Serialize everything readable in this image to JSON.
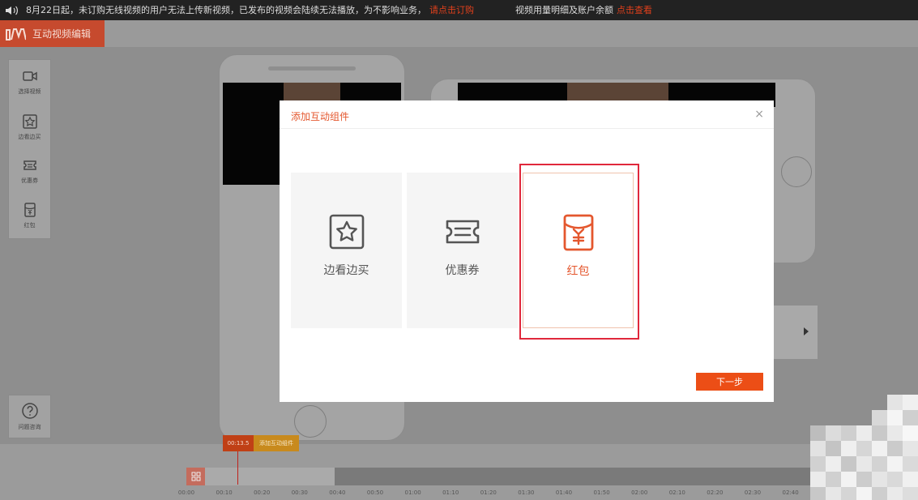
{
  "notice": {
    "message": "8月22日起，未订购无线视频的用户无法上传新视频，已发布的视频会陆续无法播放，为不影响业务，",
    "link": "请点击订购",
    "right_text": "视频用量明细及账户余额",
    "right_link": "点击查看"
  },
  "header": {
    "app_title": "互动视频编辑"
  },
  "sidebar": {
    "items": [
      {
        "label": "选择视频",
        "icon": "video-camera-icon"
      },
      {
        "label": "边看边买",
        "icon": "star-box-icon"
      },
      {
        "label": "优惠券",
        "icon": "coupon-icon"
      },
      {
        "label": "红包",
        "icon": "red-envelope-icon"
      }
    ],
    "help_label": "问题咨询"
  },
  "timeline": {
    "current_time": "00:13.5",
    "add_label": "添加互动组件",
    "ticks": [
      "00:00",
      "00:10",
      "00:20",
      "00:30",
      "00:40",
      "00:50",
      "01:00",
      "01:10",
      "01:20",
      "01:30",
      "01:40",
      "01:50",
      "02:00",
      "02:10",
      "02:20",
      "02:30",
      "02:40",
      "02:50",
      "03:00"
    ]
  },
  "modal": {
    "title": "添加互动组件",
    "close": "×",
    "cards": [
      {
        "label": "边看边买",
        "icon": "star-box-icon",
        "selected": false
      },
      {
        "label": "优惠券",
        "icon": "coupon-icon",
        "selected": false
      },
      {
        "label": "红包",
        "icon": "red-envelope-icon",
        "selected": true
      }
    ],
    "next_label": "下一步"
  },
  "colors": {
    "accent": "#e4572e",
    "button": "#ec4e16",
    "highlight": "#e0283c"
  }
}
